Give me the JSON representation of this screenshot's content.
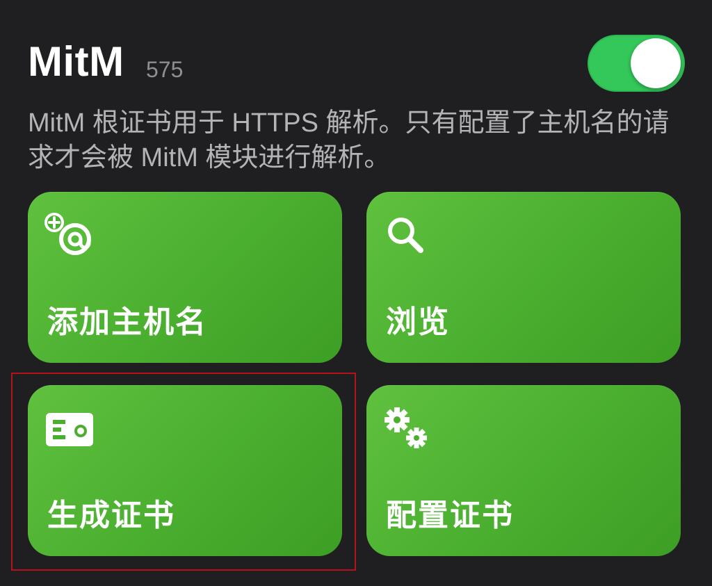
{
  "header": {
    "title": "MitM",
    "count": "575",
    "toggle_on": true
  },
  "description": "MitM 根证书用于 HTTPS 解析。只有配置了主机名的请求才会被 MitM 模块进行解析。",
  "tiles": [
    {
      "label": "添加主机名",
      "icon": "add-at-icon"
    },
    {
      "label": "浏览",
      "icon": "search-icon"
    },
    {
      "label": "生成证书",
      "icon": "certificate-card-icon"
    },
    {
      "label": "配置证书",
      "icon": "gears-icon"
    }
  ],
  "colors": {
    "background": "#1f1f21",
    "tile_green": "#4aae2f",
    "toggle_green": "#34c759",
    "highlight_red": "#b5121b"
  }
}
